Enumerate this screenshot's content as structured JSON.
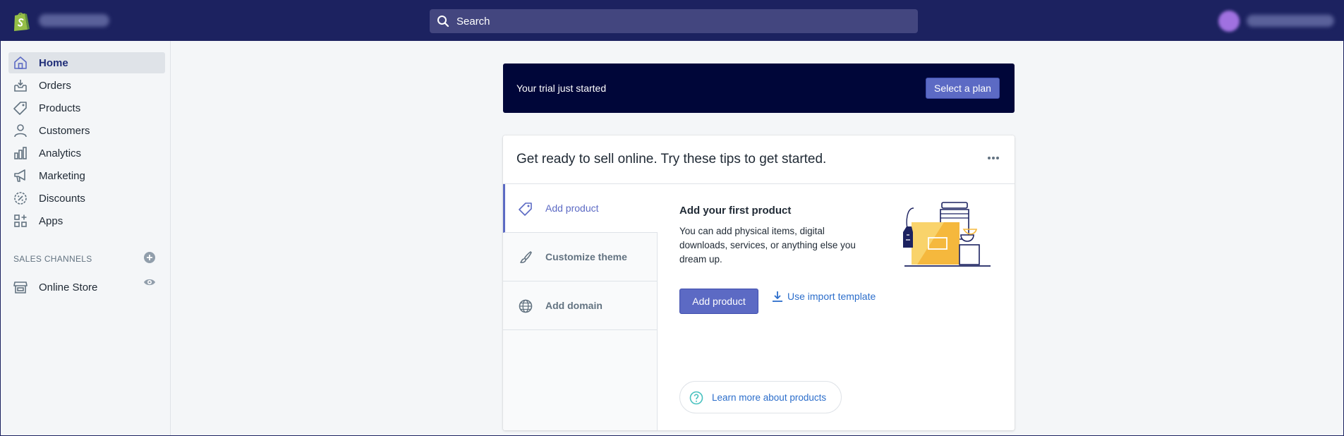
{
  "header": {
    "search_placeholder": "Search"
  },
  "sidebar": {
    "items": [
      {
        "label": "Home",
        "icon": "home-icon",
        "active": true
      },
      {
        "label": "Orders",
        "icon": "orders-icon"
      },
      {
        "label": "Products",
        "icon": "tag-icon"
      },
      {
        "label": "Customers",
        "icon": "person-icon"
      },
      {
        "label": "Analytics",
        "icon": "bar-chart-icon"
      },
      {
        "label": "Marketing",
        "icon": "megaphone-icon"
      },
      {
        "label": "Discounts",
        "icon": "discount-icon"
      },
      {
        "label": "Apps",
        "icon": "apps-icon"
      }
    ],
    "sales_channels_title": "SALES CHANNELS",
    "channels": [
      {
        "label": "Online Store",
        "icon": "store-icon"
      }
    ]
  },
  "trial_banner": {
    "text": "Your trial just started",
    "button": "Select a plan"
  },
  "tips_card": {
    "title": "Get ready to sell online. Try these tips to get started.",
    "tabs": [
      {
        "label": "Add product",
        "icon": "tag-icon",
        "active": true
      },
      {
        "label": "Customize theme",
        "icon": "brush-icon"
      },
      {
        "label": "Add domain",
        "icon": "globe-icon"
      }
    ],
    "panel": {
      "title": "Add your first product",
      "description": "You can add physical items, digital downloads, services, or anything else you dream up.",
      "primary_button": "Add product",
      "import_link": "Use import template",
      "learn_more": "Learn more about products"
    }
  },
  "colors": {
    "topbar": "#1c2260",
    "accent": "#5c6ac4",
    "banner": "#000639",
    "link": "#2c6ecb"
  }
}
